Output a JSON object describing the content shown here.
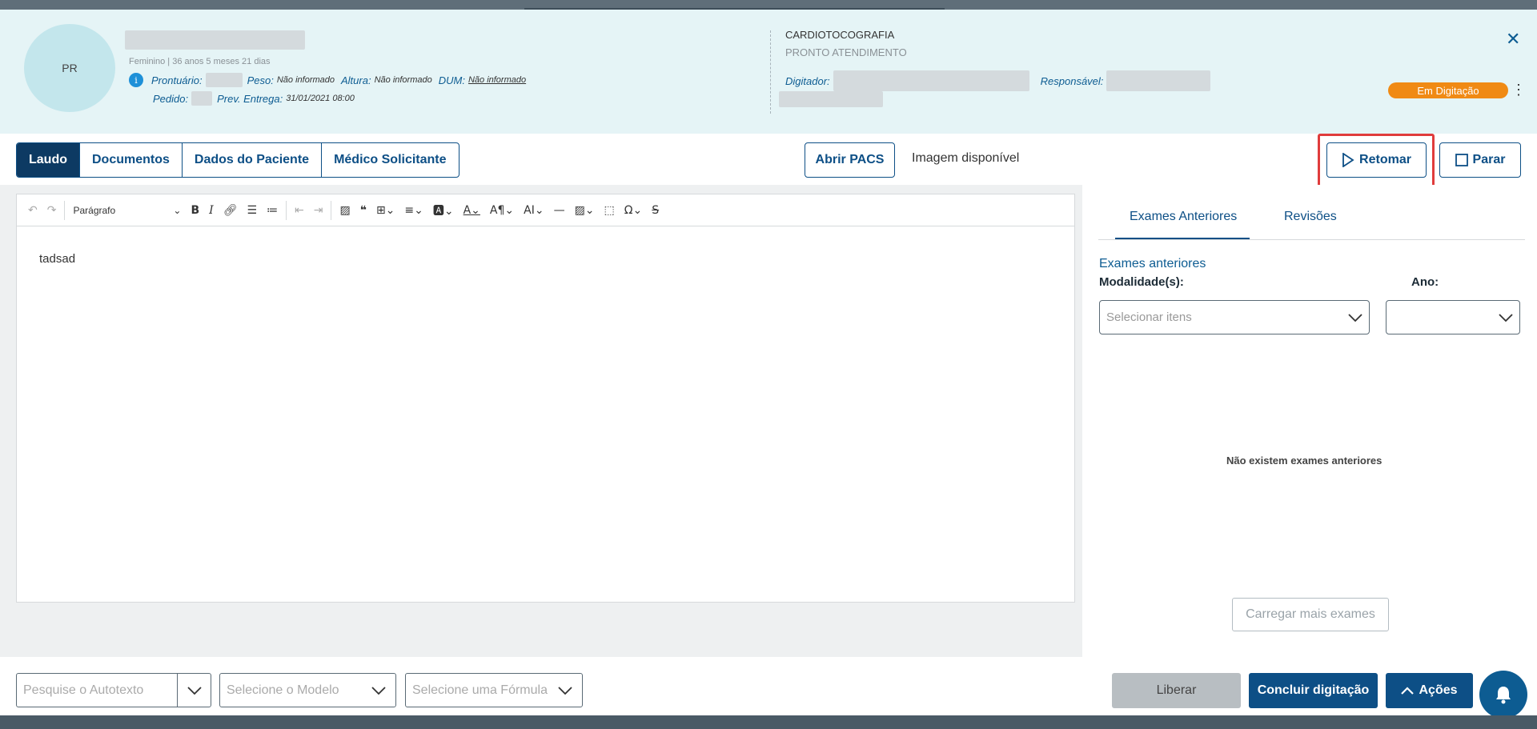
{
  "header": {
    "avatar_initials": "PR",
    "patient_info": "Feminino | 36 anos 5 meses 21 dias",
    "fields_row1": [
      {
        "label": "Prontuário:",
        "value": ""
      },
      {
        "label": "Peso:",
        "value": "Não informado"
      },
      {
        "label": "Altura:",
        "value": "Não informado"
      },
      {
        "label": "DUM:",
        "value": "Não informado"
      }
    ],
    "pedido_label": "Pedido:",
    "prev_entrega_label": "Prev. Entrega:",
    "prev_entrega_value": "31/01/2021 08:00",
    "exam_title": "CARDIOTOCOGRAFIA",
    "exam_subtitle": "PRONTO ATENDIMENTO",
    "digitador_label": "Digitador:",
    "responsavel_label": "Responsável:",
    "status_badge": "Em Digitação",
    "status_color": "#f08a14"
  },
  "toolbar": {
    "tabs": [
      "Laudo",
      "Documentos",
      "Dados do Paciente",
      "Médico Solicitante"
    ],
    "active_tab": "Laudo",
    "open_pacs": "Abrir PACS",
    "image_available": "Imagem disponível",
    "resume": "Retomar",
    "stop": "Parar"
  },
  "editor": {
    "paragraph_style": "Parágrafo",
    "content": "tadsad"
  },
  "right_panel": {
    "tabs": [
      "Exames Anteriores",
      "Revisões"
    ],
    "active_tab": "Exames Anteriores",
    "heading": "Exames anteriores",
    "modality_label": "Modalidade(s):",
    "modality_placeholder": "Selecionar itens",
    "year_label": "Ano:",
    "empty_message": "Não existem exames anteriores",
    "load_more": "Carregar mais exames"
  },
  "bottom": {
    "autotext_placeholder": "Pesquise o Autotexto",
    "model_placeholder": "Selecione o Modelo",
    "formula_placeholder": "Selecione uma Fórmula",
    "release": "Liberar",
    "finish": "Concluir digitação",
    "actions": "Ações"
  },
  "colors": {
    "primary": "#0d4f86",
    "header_bg": "#e5f4f6",
    "highlight": "#e03c3c"
  }
}
